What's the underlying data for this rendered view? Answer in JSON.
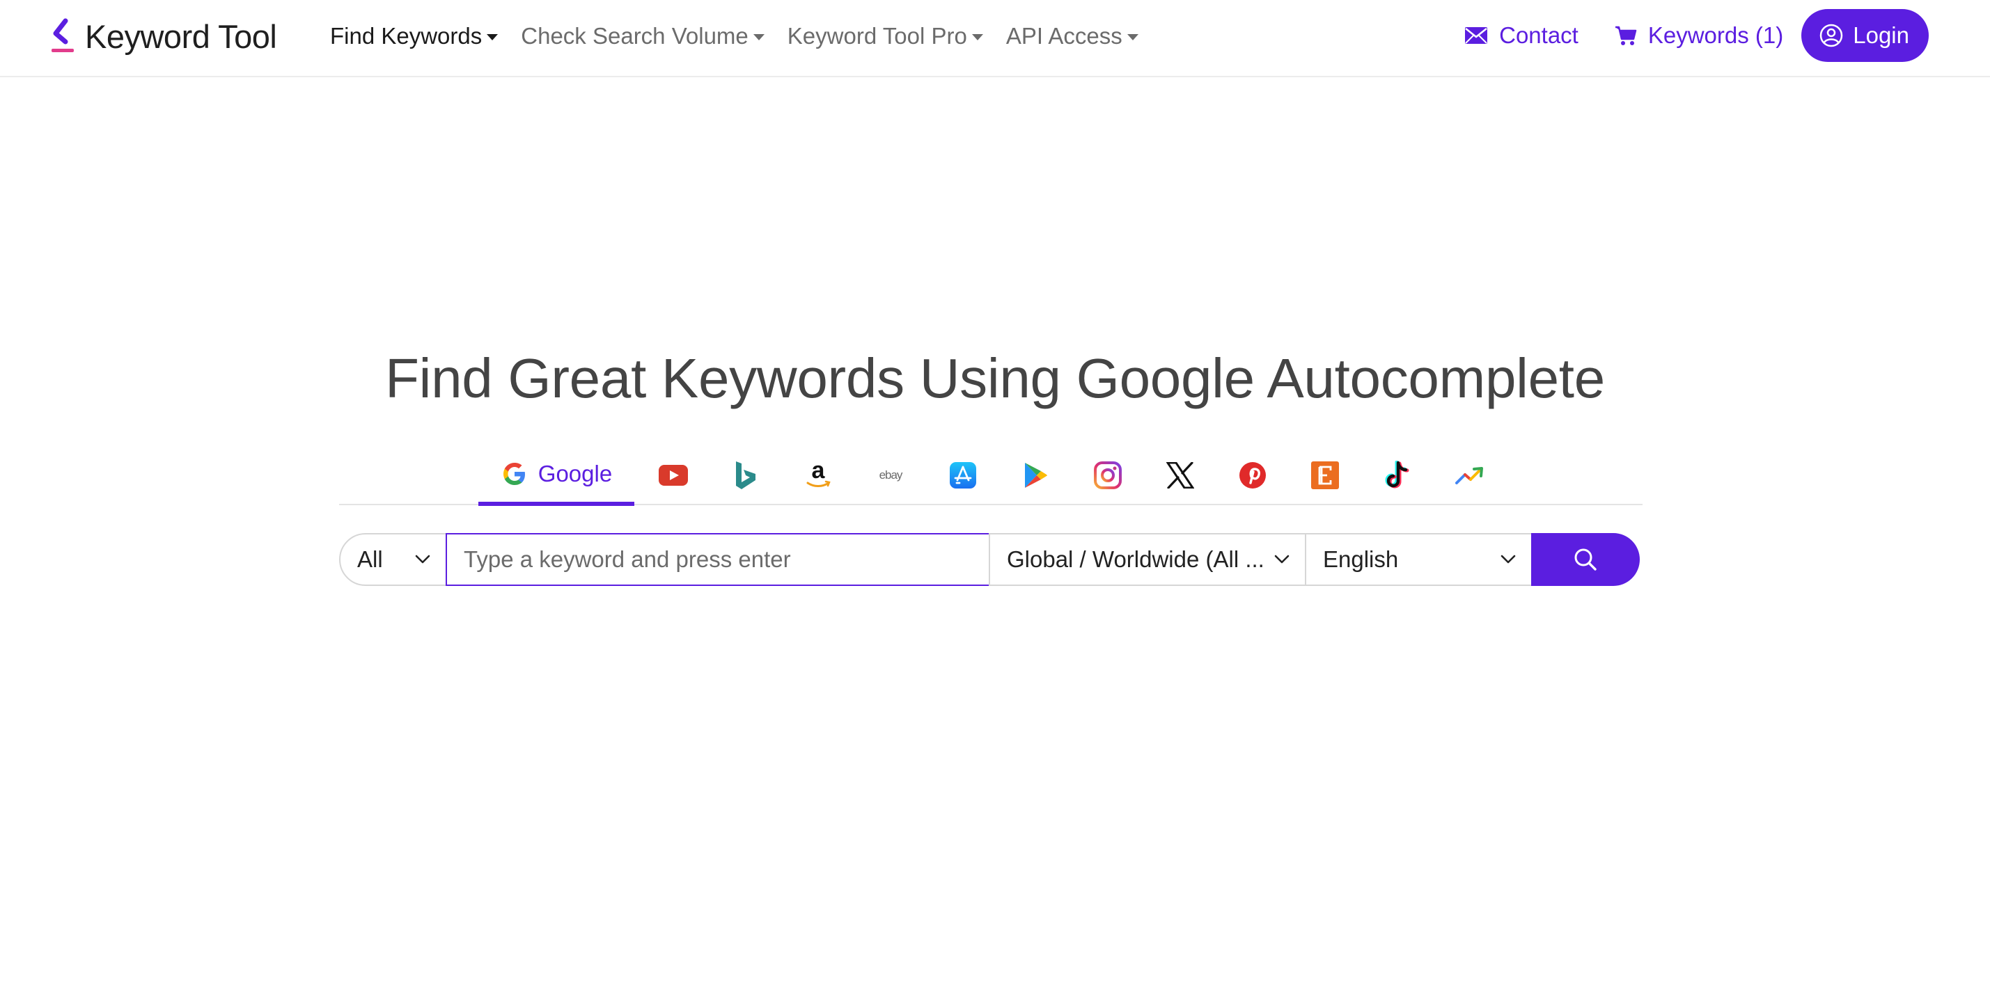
{
  "brand": {
    "name": "Keyword Tool"
  },
  "nav": {
    "items": [
      {
        "label": "Find Keywords",
        "active": true
      },
      {
        "label": "Check Search Volume",
        "active": false
      },
      {
        "label": "Keyword Tool Pro",
        "active": false
      },
      {
        "label": "API Access",
        "active": false
      }
    ],
    "contact_label": "Contact",
    "cart_label": "Keywords (1)",
    "login_label": "Login"
  },
  "hero": {
    "title": "Find Great Keywords Using Google Autocomplete"
  },
  "sources": {
    "active": "google",
    "google_label": "Google",
    "ebay_text": "ebay",
    "items": [
      "google",
      "youtube",
      "bing",
      "amazon",
      "ebay",
      "app-store",
      "play-store",
      "instagram",
      "x",
      "pinterest",
      "etsy",
      "tiktok",
      "trends"
    ]
  },
  "search": {
    "type_value": "All",
    "keyword_placeholder": "Type a keyword and press enter",
    "country_value": "Global / Worldwide (All ...",
    "language_value": "English"
  },
  "colors": {
    "accent": "#5b1ee0",
    "title": "#444444",
    "nav_inactive": "#6b6b6b"
  }
}
